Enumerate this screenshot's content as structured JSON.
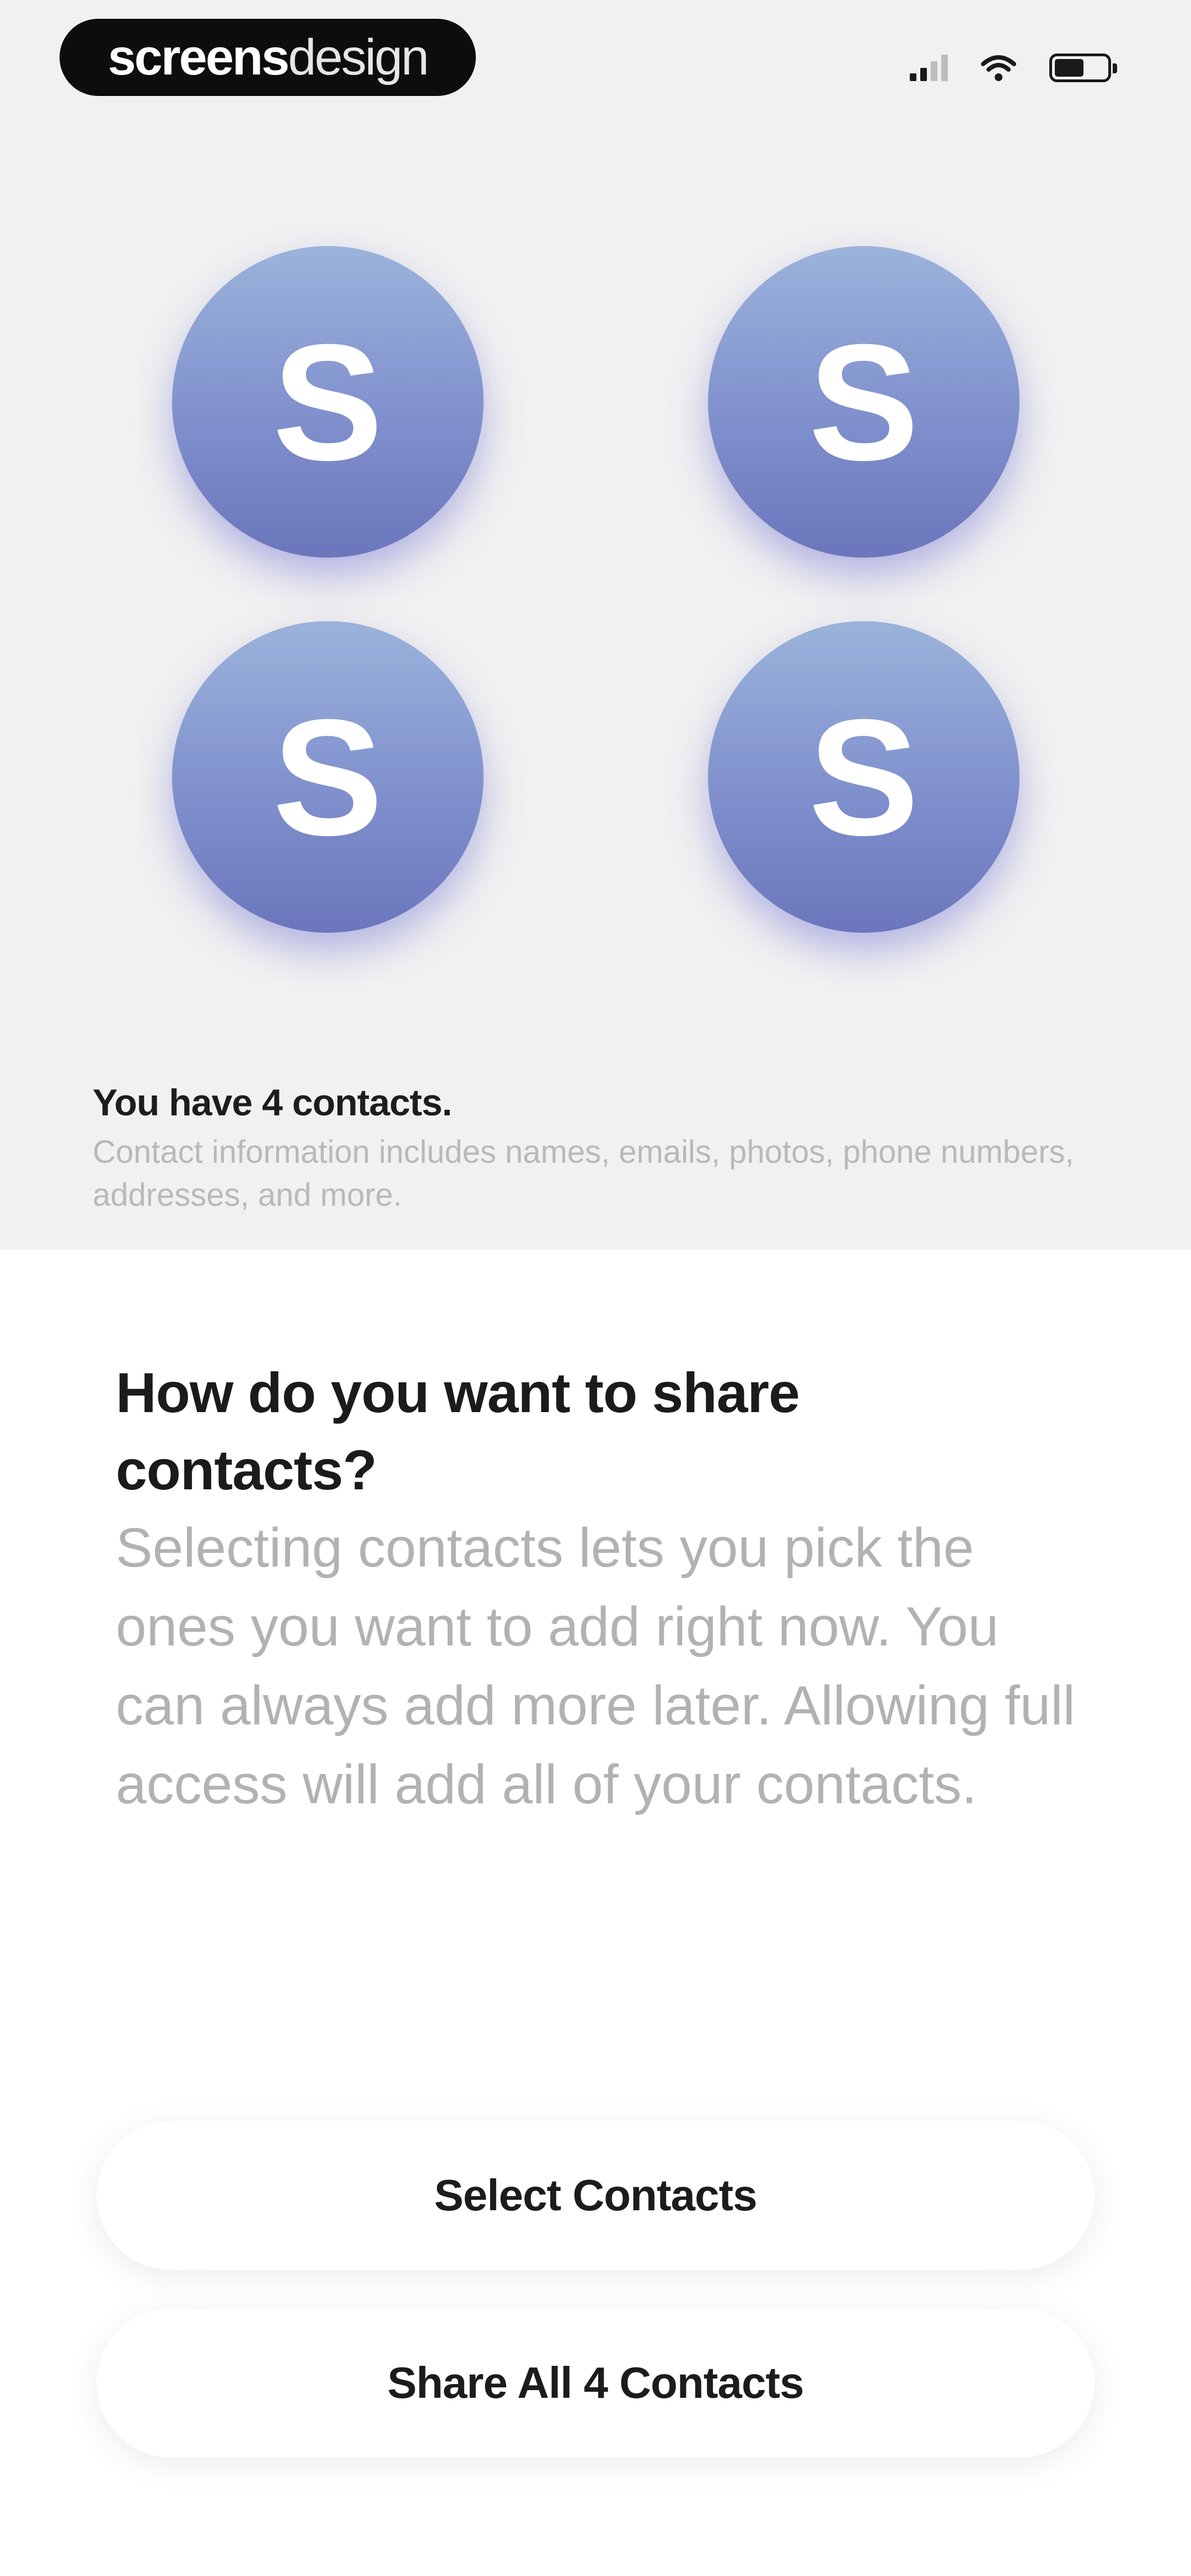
{
  "status_bar": {
    "logo_part1": "screens",
    "logo_part2": "design",
    "icons": [
      "signal-icon",
      "wifi-icon",
      "battery-icon"
    ]
  },
  "avatars": [
    {
      "initial": "S"
    },
    {
      "initial": "S"
    },
    {
      "initial": "S"
    },
    {
      "initial": "S"
    }
  ],
  "summary": {
    "count_text": "You have 4 contacts.",
    "description": "Contact information includes names, emails, photos, phone numbers, addresses, and more."
  },
  "prompt": {
    "title": "How do you want to share contacts?",
    "body": "Selecting contacts lets you pick the ones you want to add right now. You can always add more later. Allowing full access will add all of your contacts."
  },
  "actions": {
    "select_label": "Select Contacts",
    "share_all_label": "Share All 4 Contacts"
  },
  "colors": {
    "avatar_top": "#9bb3db",
    "avatar_bottom": "#6b76bc",
    "top_background": "#f1f1f1",
    "muted_text": "#b2b2b2"
  }
}
